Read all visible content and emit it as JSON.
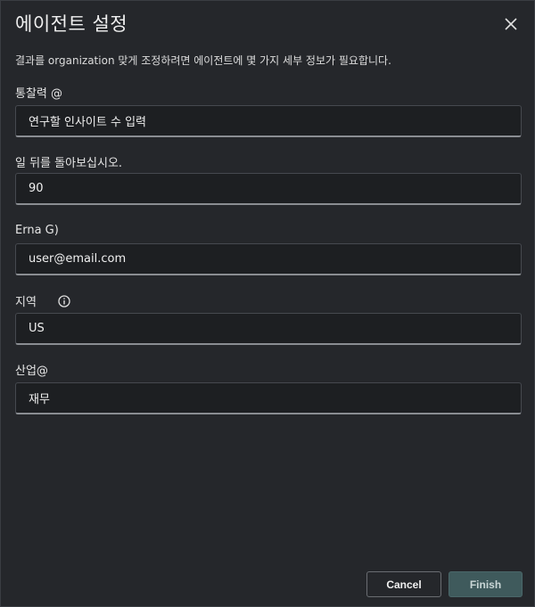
{
  "dialog": {
    "title": "에이전트 설정",
    "description": "결과를 organization 맞게 조정하려면 에이전트에 몇 가지 세부 정보가 필요합니다."
  },
  "fields": [
    {
      "label": "통찰력 @",
      "value": "연구할 인사이트 수 입력"
    },
    {
      "label": "일 뒤를 돌아보십시오.",
      "value": "90"
    },
    {
      "label": "Erna G)",
      "value": "user@email.com"
    },
    {
      "label": "지역",
      "value": "US"
    },
    {
      "label": "산업@",
      "value": "재무"
    }
  ],
  "buttons": {
    "cancel": "Cancel",
    "finish": "Finish"
  },
  "icons": {
    "close": "close-icon",
    "info": "info-icon"
  }
}
